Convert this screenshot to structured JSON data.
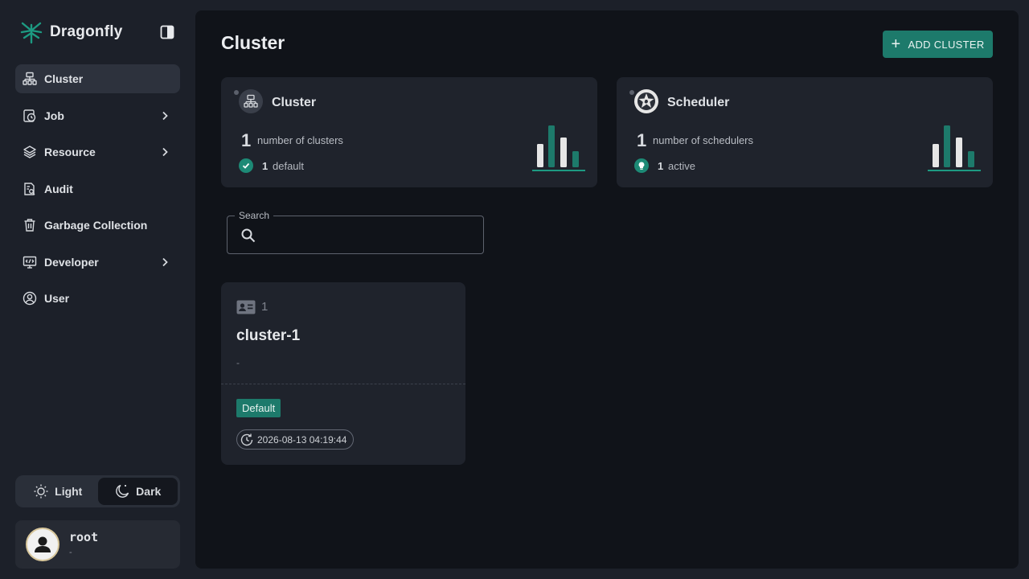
{
  "brand": {
    "name": "Dragonfly",
    "logo_icon": "dragonfly-logo-icon"
  },
  "sidebar": {
    "items": [
      {
        "label": "Cluster",
        "icon": "cluster-icon",
        "active": true,
        "has_submenu": false
      },
      {
        "label": "Job",
        "icon": "job-icon",
        "active": false,
        "has_submenu": true
      },
      {
        "label": "Resource",
        "icon": "layers-icon",
        "active": false,
        "has_submenu": true
      },
      {
        "label": "Audit",
        "icon": "audit-icon",
        "active": false,
        "has_submenu": false
      },
      {
        "label": "Garbage Collection",
        "icon": "trash-icon",
        "active": false,
        "has_submenu": false
      },
      {
        "label": "Developer",
        "icon": "developer-icon",
        "active": false,
        "has_submenu": true
      },
      {
        "label": "User",
        "icon": "user-circle-icon",
        "active": false,
        "has_submenu": false
      }
    ]
  },
  "theme": {
    "light_label": "Light",
    "dark_label": "Dark",
    "selected": "Dark"
  },
  "user": {
    "name": "root",
    "subtitle": "-"
  },
  "header": {
    "title": "Cluster",
    "add_button_label": "ADD CLUSTER"
  },
  "stats": {
    "cluster": {
      "title": "Cluster",
      "count": "1",
      "count_label": "number of clusters",
      "sub_count": "1",
      "sub_label": "default"
    },
    "scheduler": {
      "title": "Scheduler",
      "count": "1",
      "count_label": "number of schedulers",
      "sub_count": "1",
      "sub_label": "active"
    }
  },
  "search": {
    "label": "Search",
    "value": ""
  },
  "clusters": [
    {
      "id": "1",
      "name": "cluster-1",
      "description": "-",
      "badge": "Default",
      "created_at": "2026-08-13 04:19:44"
    }
  ],
  "colors": {
    "accent": "#1d7a6b",
    "background": "#101319",
    "card": "#1f232c",
    "sidebar": "#1c2029"
  }
}
